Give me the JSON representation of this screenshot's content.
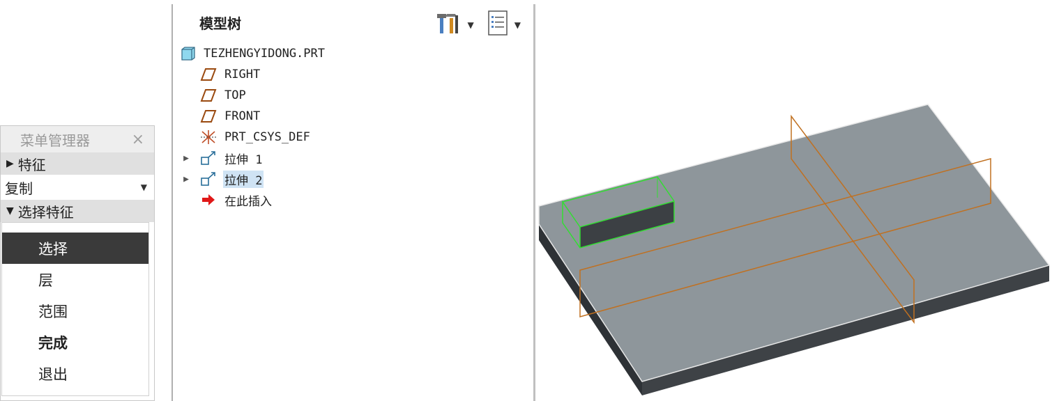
{
  "menu_manager": {
    "title": "菜单管理器",
    "close_glyph": "×",
    "feature_section": "特征",
    "copy_dropdown": "复制",
    "select_feature_section": "选择特征",
    "items": [
      {
        "label": "选择",
        "selected": true
      },
      {
        "label": "层"
      },
      {
        "label": "范围"
      },
      {
        "label": "完成",
        "bold": true
      },
      {
        "label": "退出"
      }
    ]
  },
  "model_tree": {
    "title": "模型树",
    "tools": [
      {
        "icon": "settings-tools-icon"
      },
      {
        "icon": "show-list-icon"
      }
    ],
    "nodes": [
      {
        "label": "TEZHENGYIDONG.PRT",
        "icon": "part-icon"
      },
      {
        "label": "RIGHT",
        "icon": "datum-plane-icon"
      },
      {
        "label": "TOP",
        "icon": "datum-plane-icon"
      },
      {
        "label": "FRONT",
        "icon": "datum-plane-icon"
      },
      {
        "label": "PRT_CSYS_DEF",
        "icon": "csys-icon"
      },
      {
        "label": "拉伸 1",
        "icon": "extrude-icon",
        "expandable": true
      },
      {
        "label": "拉伸 2",
        "icon": "extrude-icon",
        "expandable": true,
        "highlighted": true
      },
      {
        "label": "在此插入",
        "icon": "insert-here-arrow-icon"
      }
    ]
  },
  "colors": {
    "selection_green": "#33dd33",
    "datum_orange": "#c07020",
    "plate_top": "#8e969b",
    "plate_side": "#4a4e52",
    "selected_menu_bg": "#3a3a3a",
    "highlight_bg": "#cfe3f4"
  }
}
